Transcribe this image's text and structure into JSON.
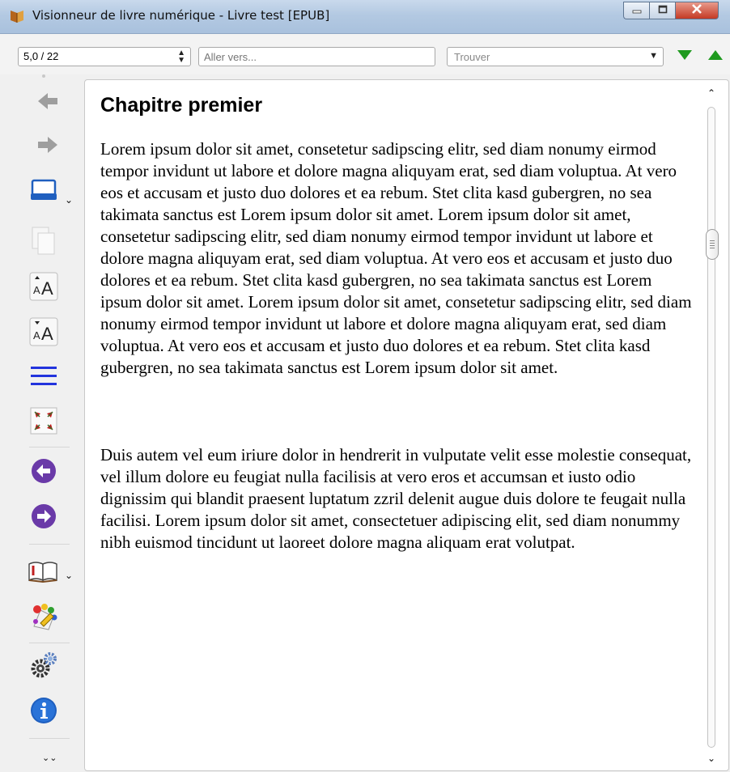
{
  "window": {
    "title": "Visionneur de livre numérique - Livre test [EPUB]",
    "icons": {
      "app": "book-app-icon",
      "minimize": "minimize-icon",
      "maximize": "maximize-icon",
      "close": "close-icon"
    }
  },
  "toolbar": {
    "page_position": "5,0 / 22",
    "goto_placeholder": "Aller vers...",
    "find_placeholder": "Trouver",
    "find_next_icon": "green-down-arrow-icon",
    "find_prev_icon": "green-up-arrow-icon",
    "colors": {
      "find_arrows": "#1f9a1f"
    }
  },
  "sidebar": {
    "tools": [
      {
        "icon": "back-arrow-icon"
      },
      {
        "icon": "forward-arrow-icon"
      },
      {
        "icon": "print-icon",
        "has_dropdown": true
      },
      {
        "icon": "copy-icon"
      },
      {
        "icon": "font-size-increase-icon"
      },
      {
        "icon": "font-size-decrease-icon"
      },
      {
        "icon": "toc-lines-icon"
      },
      {
        "icon": "fullscreen-icon"
      },
      {
        "icon": "previous-page-icon"
      },
      {
        "icon": "next-page-icon"
      },
      {
        "icon": "bookmarks-book-icon",
        "has_dropdown": true
      },
      {
        "icon": "theme-palette-icon"
      },
      {
        "icon": "settings-gears-icon"
      },
      {
        "icon": "info-icon"
      },
      {
        "icon": "more-chevron-icon"
      }
    ],
    "colors": {
      "nav_circle": "#6a3aa8",
      "info": "#1f5fbf",
      "toc_lines": "#2233dd"
    }
  },
  "book": {
    "chapter_title": "Chapitre premier",
    "paragraphs": [
      "Lorem ipsum dolor sit amet, consetetur sadipscing elitr, sed diam nonumy eirmod tempor invidunt ut labore et dolore magna aliquyam erat, sed diam voluptua. At vero eos et accusam et justo duo dolores et ea rebum. Stet clita kasd gubergren, no sea takimata sanctus est Lorem ipsum dolor sit amet. Lorem ipsum dolor sit amet, consetetur sadipscing elitr, sed diam nonumy eirmod tempor invidunt ut labore et dolore magna aliquyam erat, sed diam voluptua. At vero eos et accusam et justo duo dolores et ea rebum. Stet clita kasd gubergren, no sea takimata sanctus est Lorem ipsum dolor sit amet. Lorem ipsum dolor sit amet, consetetur sadipscing elitr, sed diam nonumy eirmod tempor invidunt ut labore et dolore magna aliquyam erat, sed diam voluptua. At vero eos et accusam et justo duo dolores et ea rebum. Stet clita kasd gubergren, no sea takimata sanctus est Lorem ipsum dolor sit amet.",
      "Duis autem vel eum iriure dolor in hendrerit in vulputate velit esse molestie consequat, vel illum dolore eu feugiat nulla facilisis at vero eros et accumsan et iusto odio dignissim qui blandit praesent luptatum zzril delenit augue duis dolore te feugait nulla facilisi. Lorem ipsum dolor sit amet, consectetuer adipiscing elit, sed diam nonummy nibh euismod tincidunt ut laoreet dolore magna aliquam erat volutpat."
    ]
  },
  "scrollbar": {
    "position": 0.2
  }
}
